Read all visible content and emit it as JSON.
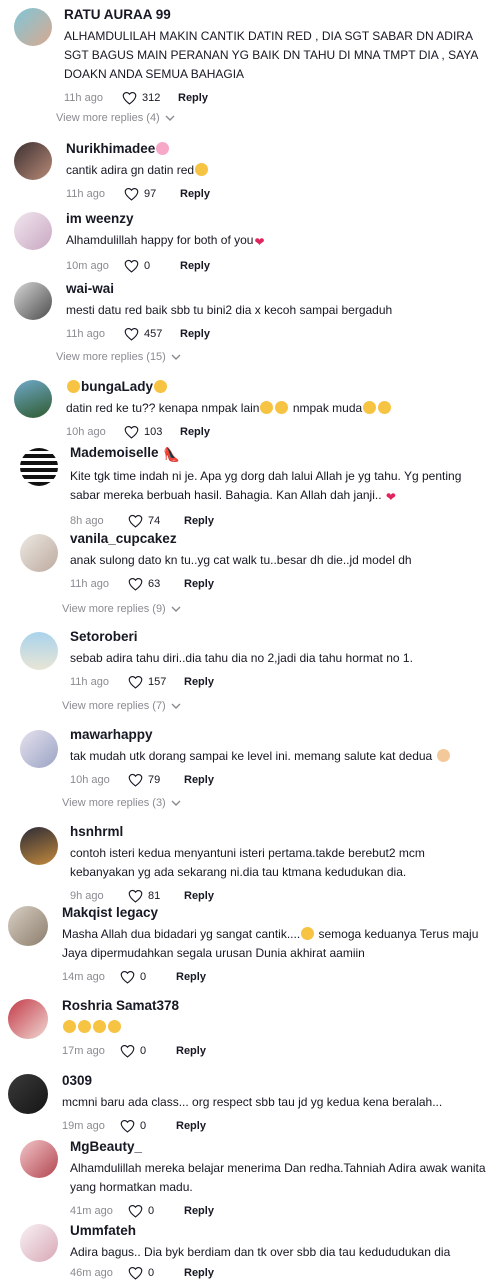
{
  "ui": {
    "reply_label": "Reply"
  },
  "comments": [
    {
      "username": "RATU AURAA 99",
      "text": "ALHAMDULILAH MAKIN CANTIK DATIN RED , DIA SGT SABAR DN ADIRA SGT BAGUS MAIN PERANAN YG BAIK DN TAHU DI MNA TMPT DIA , SAYA DOAKN ANDA SEMUA BAHAGIA",
      "time": "11h ago",
      "likes": "312",
      "view_more": "View more replies (4)"
    },
    {
      "username": "Nurikhimadee",
      "text": "cantik adira gn datin red",
      "time": "11h ago",
      "likes": "97",
      "view_more": ""
    },
    {
      "username": "im weenzy",
      "text": "Alhamdulillah happy for both of you",
      "time": "10m ago",
      "likes": "0",
      "view_more": ""
    },
    {
      "username": "wai-wai",
      "text": "mesti datu red baik sbb tu bini2 dia x kecoh sampai bergaduh",
      "time": "11h ago",
      "likes": "457",
      "view_more": "View more replies (15)"
    },
    {
      "username": "bungaLady",
      "text": "datin red ke tu?? kenapa nmpak lain",
      "text_b": "nmpak muda",
      "time": "10h ago",
      "likes": "103",
      "view_more": ""
    },
    {
      "username": "Mademoiselle",
      "text": "Kite tgk time indah ni je. Apa yg dorg dah lalui Allah je yg tahu. Yg penting sabar mereka berbuah hasil. Bahagia. Kan Allah dah janji..",
      "time": "8h ago",
      "likes": "74",
      "view_more": ""
    },
    {
      "username": "vanila_cupcakez",
      "text": "anak sulong dato kn tu..yg cat walk tu..besar dh die..jd model dh",
      "time": "11h ago",
      "likes": "63",
      "view_more": "View more replies (9)"
    },
    {
      "username": "Setoroberi",
      "text": "sebab adira tahu diri..dia tahu dia no 2,jadi dia tahu hormat no 1.",
      "time": "11h ago",
      "likes": "157",
      "view_more": "View more replies (7)"
    },
    {
      "username": "mawarhappy",
      "text": "tak mudah utk dorang sampai ke level ini. memang salute kat dedua",
      "time": "10h ago",
      "likes": "79",
      "view_more": "View more replies (3)"
    },
    {
      "username": "hsnhrml",
      "text": "contoh isteri kedua menyantuni isteri pertama.takde berebut2 mcm kebanyakan yg ada sekarang ni.dia tau ktmana kedudukan dia.",
      "time": "9h ago",
      "likes": "81",
      "view_more": ""
    },
    {
      "username": "Makqist legacy",
      "text": "Masha Allah dua bidadari yg sangat cantik....",
      "text_b": "semoga keduanya Terus maju Jaya dipermudahkan segala urusan Dunia akhirat aamiin",
      "time": "14m ago",
      "likes": "0",
      "view_more": ""
    },
    {
      "username": "Roshria Samat378",
      "text": "",
      "time": "17m ago",
      "likes": "0",
      "view_more": ""
    },
    {
      "username": "0309",
      "text": "mcmni baru ada class... org respect sbb tau jd yg kedua kena beralah...",
      "time": "19m ago",
      "likes": "0",
      "view_more": ""
    },
    {
      "username": "MgBeauty_",
      "text": "Alhamdulillah mereka belajar menerima Dan redha.Tahniah Adira awak wanita yang hormatkan madu.",
      "time": "41m ago",
      "likes": "0",
      "view_more": ""
    },
    {
      "username": "Ummfateh",
      "text": "Adira bagus.. Dia byk berdiam dan tk over sbb dia tau kedududukan dia",
      "time": "46m ago",
      "likes": "0",
      "view_more": ""
    }
  ],
  "colors": {
    "text": "#161823",
    "muted": "#8a8b91",
    "heart_emoji": "#e0245e"
  }
}
